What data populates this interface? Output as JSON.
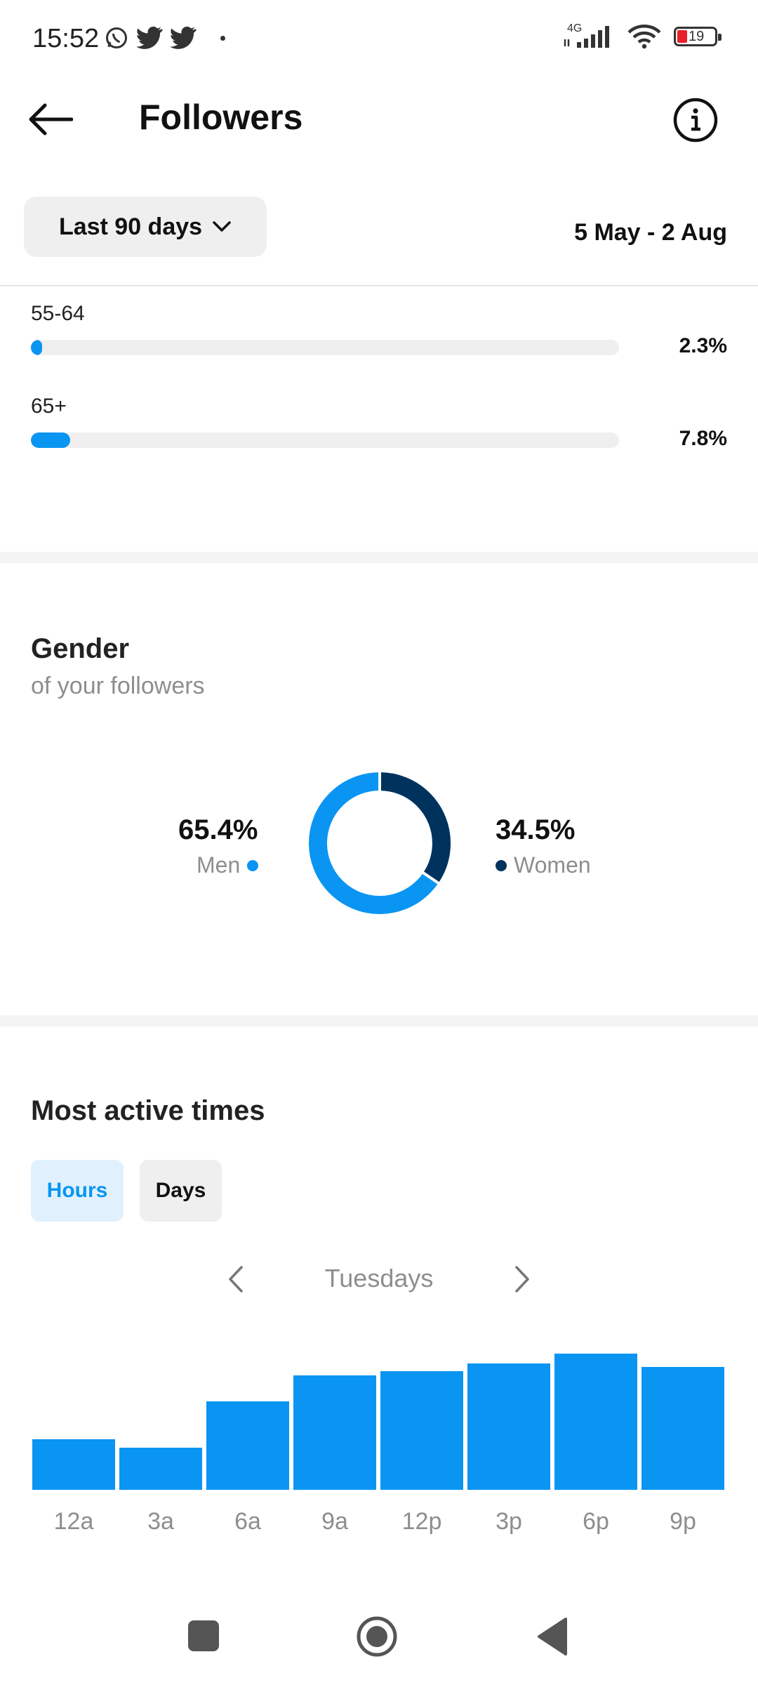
{
  "status_bar": {
    "time": "15:52",
    "network": "4G",
    "battery": "19",
    "left_icons": [
      "whatsapp-icon",
      "twitter-icon",
      "twitter-icon",
      "dot-icon"
    ],
    "right_icons": [
      "signal-icon",
      "wifi-icon",
      "battery-icon"
    ]
  },
  "header": {
    "title": "Followers",
    "back_icon": "arrow-left-icon",
    "info_icon": "info-icon"
  },
  "filter": {
    "range_label": "Last 90 days",
    "date_range": "5 May - 2 Aug"
  },
  "age_groups": [
    {
      "label": "55-64",
      "percent_text": "2.3%",
      "value": 2.3
    },
    {
      "label": "65+",
      "percent_text": "7.8%",
      "value": 7.8
    }
  ],
  "gender": {
    "title": "Gender",
    "subtitle": "of your followers",
    "men": {
      "percent": "65.4%",
      "label": "Men",
      "value": 65.4,
      "color": "#0a95f3"
    },
    "women": {
      "percent": "34.5%",
      "label": "Women",
      "value": 34.5,
      "color": "#00325e"
    }
  },
  "most_active": {
    "title": "Most active times",
    "tabs": [
      {
        "label": "Hours",
        "active": true
      },
      {
        "label": "Days",
        "active": false
      }
    ],
    "day": "Tuesdays"
  },
  "chart_data": {
    "type": "bar",
    "categories": [
      "12a",
      "3a",
      "6a",
      "9a",
      "12p",
      "3p",
      "6p",
      "9p"
    ],
    "values": [
      37,
      31,
      65,
      84,
      87,
      93,
      100,
      90
    ],
    "ylim": [
      0,
      100
    ],
    "grid": false,
    "color": "#0a95f3"
  },
  "system_nav": [
    "recents-square-icon",
    "home-circle-icon",
    "back-triangle-icon"
  ]
}
